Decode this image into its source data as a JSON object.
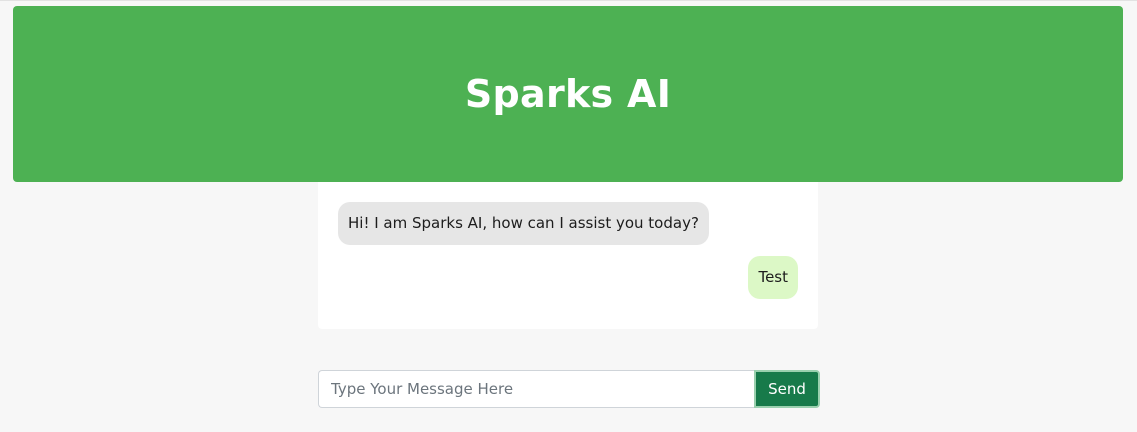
{
  "header": {
    "title": "Sparks AI"
  },
  "chat": {
    "messages": [
      {
        "sender": "bot",
        "text": "Hi! I am Sparks AI, how can I assist you today?"
      },
      {
        "sender": "user",
        "text": "Test"
      }
    ]
  },
  "composer": {
    "placeholder": "Type Your Message Here",
    "value": "",
    "send_label": "Send"
  },
  "colors": {
    "header_bg": "#4db153",
    "bot_bubble": "#e6e6e6",
    "user_bubble": "#dcf8c6",
    "send_button": "#177a4a",
    "page_bg": "#f7f7f7"
  }
}
